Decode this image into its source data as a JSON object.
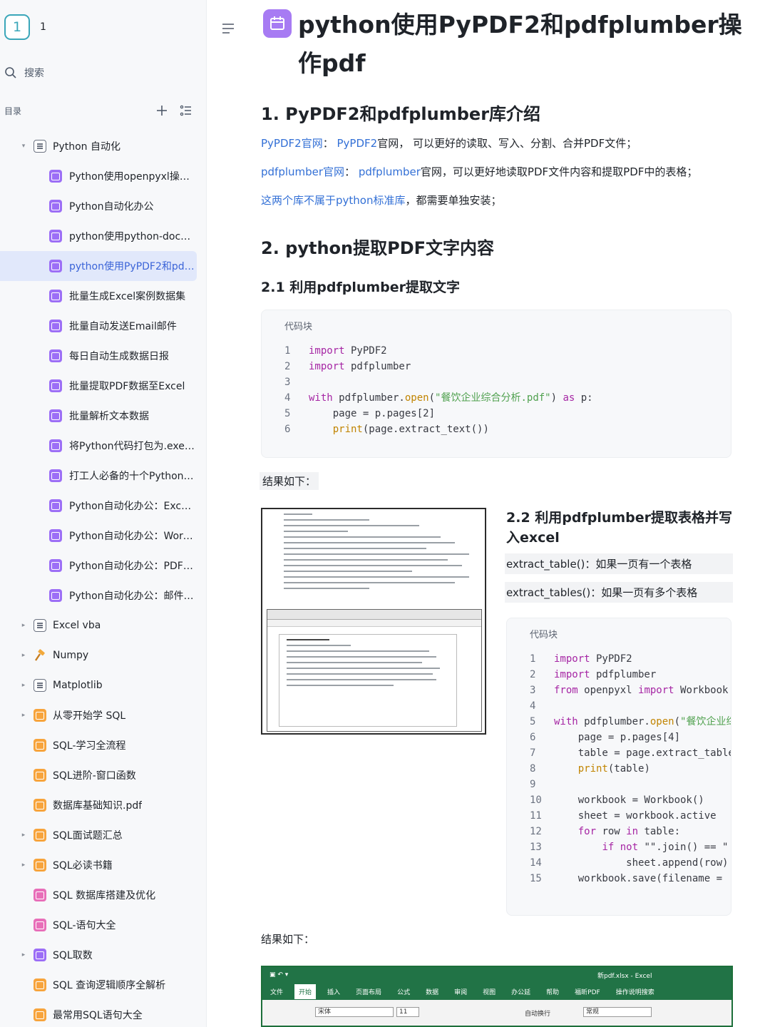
{
  "workspace": {
    "badge": "1",
    "name": "1"
  },
  "search": {
    "label": "搜索"
  },
  "toc": {
    "label": "目录"
  },
  "tree": [
    {
      "label": "Python 自动化",
      "level": 0,
      "icon": "doc",
      "arrow": "▾"
    },
    {
      "label": "Python使用openpyxl操作e...",
      "level": 1,
      "icon": "purple"
    },
    {
      "label": "Python自动化办公",
      "level": 1,
      "icon": "purple"
    },
    {
      "label": "python使用python-docx操...",
      "level": 1,
      "icon": "purple"
    },
    {
      "label": "python使用PyPDF2和pdfp...",
      "level": 1,
      "icon": "purple",
      "active": true
    },
    {
      "label": "批量生成Excel案例数据集",
      "level": 1,
      "icon": "purple"
    },
    {
      "label": "批量自动发送Email邮件",
      "level": 1,
      "icon": "purple"
    },
    {
      "label": "每日自动生成数据日报",
      "level": 1,
      "icon": "purple"
    },
    {
      "label": "批量提取PDF数据至Excel",
      "level": 1,
      "icon": "purple"
    },
    {
      "label": "批量解析文本数据",
      "level": 1,
      "icon": "purple"
    },
    {
      "label": "将Python代码打包为.exe程序",
      "level": 1,
      "icon": "purple"
    },
    {
      "label": "打工人必备的十个Python自...",
      "level": 1,
      "icon": "purple"
    },
    {
      "label": "Python自动化办公：Excel...",
      "level": 1,
      "icon": "purple"
    },
    {
      "label": "Python自动化办公：Word...",
      "level": 1,
      "icon": "purple"
    },
    {
      "label": "Python自动化办公：PDF自...",
      "level": 1,
      "icon": "purple"
    },
    {
      "label": "Python自动化办公：邮件自...",
      "level": 1,
      "icon": "purple"
    },
    {
      "label": "Excel vba",
      "level": 0,
      "icon": "doc",
      "arrow": "▸"
    },
    {
      "label": "Numpy",
      "level": 0,
      "icon": "hammer",
      "arrow": "▸"
    },
    {
      "label": "Matplotlib",
      "level": 0,
      "icon": "doc",
      "arrow": "▸"
    },
    {
      "label": "从零开始学 SQL",
      "level": 0,
      "icon": "orange",
      "arrow": "▸"
    },
    {
      "label": "SQL-学习全流程",
      "level": 0,
      "icon": "orange"
    },
    {
      "label": "SQL进阶-窗口函数",
      "level": 0,
      "icon": "orange"
    },
    {
      "label": "数据库基础知识.pdf",
      "level": 0,
      "icon": "orange"
    },
    {
      "label": "SQL面试题汇总",
      "level": 0,
      "icon": "orange",
      "arrow": "▸"
    },
    {
      "label": "SQL必读书籍",
      "level": 0,
      "icon": "orange",
      "arrow": "▸"
    },
    {
      "label": "SQL 数据库搭建及优化",
      "level": 0,
      "icon": "pink"
    },
    {
      "label": "SQL-语句大全",
      "level": 0,
      "icon": "pink"
    },
    {
      "label": "SQL取数",
      "level": 0,
      "icon": "purple",
      "arrow": "▸"
    },
    {
      "label": "SQL 查询逻辑顺序全解析",
      "level": 0,
      "icon": "orange"
    },
    {
      "label": "最常用SQL语句大全",
      "level": 0,
      "icon": "orange"
    }
  ],
  "doc": {
    "title": "python使用PyPDF2和pdfplumber操作pdf",
    "h1": "1. PyPDF2和pdfplumber库介绍",
    "p1_link": "PyPDF2官网",
    "p1_colon": "：",
    "p1_link2": "PyPDF2",
    "p1_text": "官网， 可以更好的读取、写入、分割、合并PDF文件；",
    "p2_link": "pdfplumber官网",
    "p2_colon": "：",
    "p2_link2": "pdfplumber",
    "p2_text": "官网，可以更好地读取PDF文件内容和提取PDF中的表格；",
    "p3_link": "这两个库不属于python标准库",
    "p3_text": "，都需要单独安装；",
    "h2": "2. python提取PDF文字内容",
    "h21": "2.1 利用pdfplumber提取文字",
    "code_label": "代码块",
    "result1": "结果如下：",
    "h22": "2.2 利用pdfplumber提取表格并写入excel",
    "ic1": "extract_table()：如果一页有一个表格",
    "ic2": "extract_tables()：如果一页有多个表格",
    "code_label2": "代码块",
    "result2": "结果如下："
  },
  "excel": {
    "filename": "新pdf.xlsx - Excel",
    "tabs": [
      "文件",
      "开始",
      "插入",
      "页面布局",
      "公式",
      "数据",
      "审阅",
      "视图",
      "办公延",
      "帮助",
      "福昕PDF",
      "操作说明搜索"
    ],
    "font": "宋体",
    "size": "11",
    "wrap": "自动换行",
    "format": "常规"
  },
  "colors": {
    "accent": "#3b64d8",
    "link": "#3370d6",
    "badge": "#3aa6b9",
    "doc_icon": "#a77bf3",
    "excel": "#217346"
  }
}
